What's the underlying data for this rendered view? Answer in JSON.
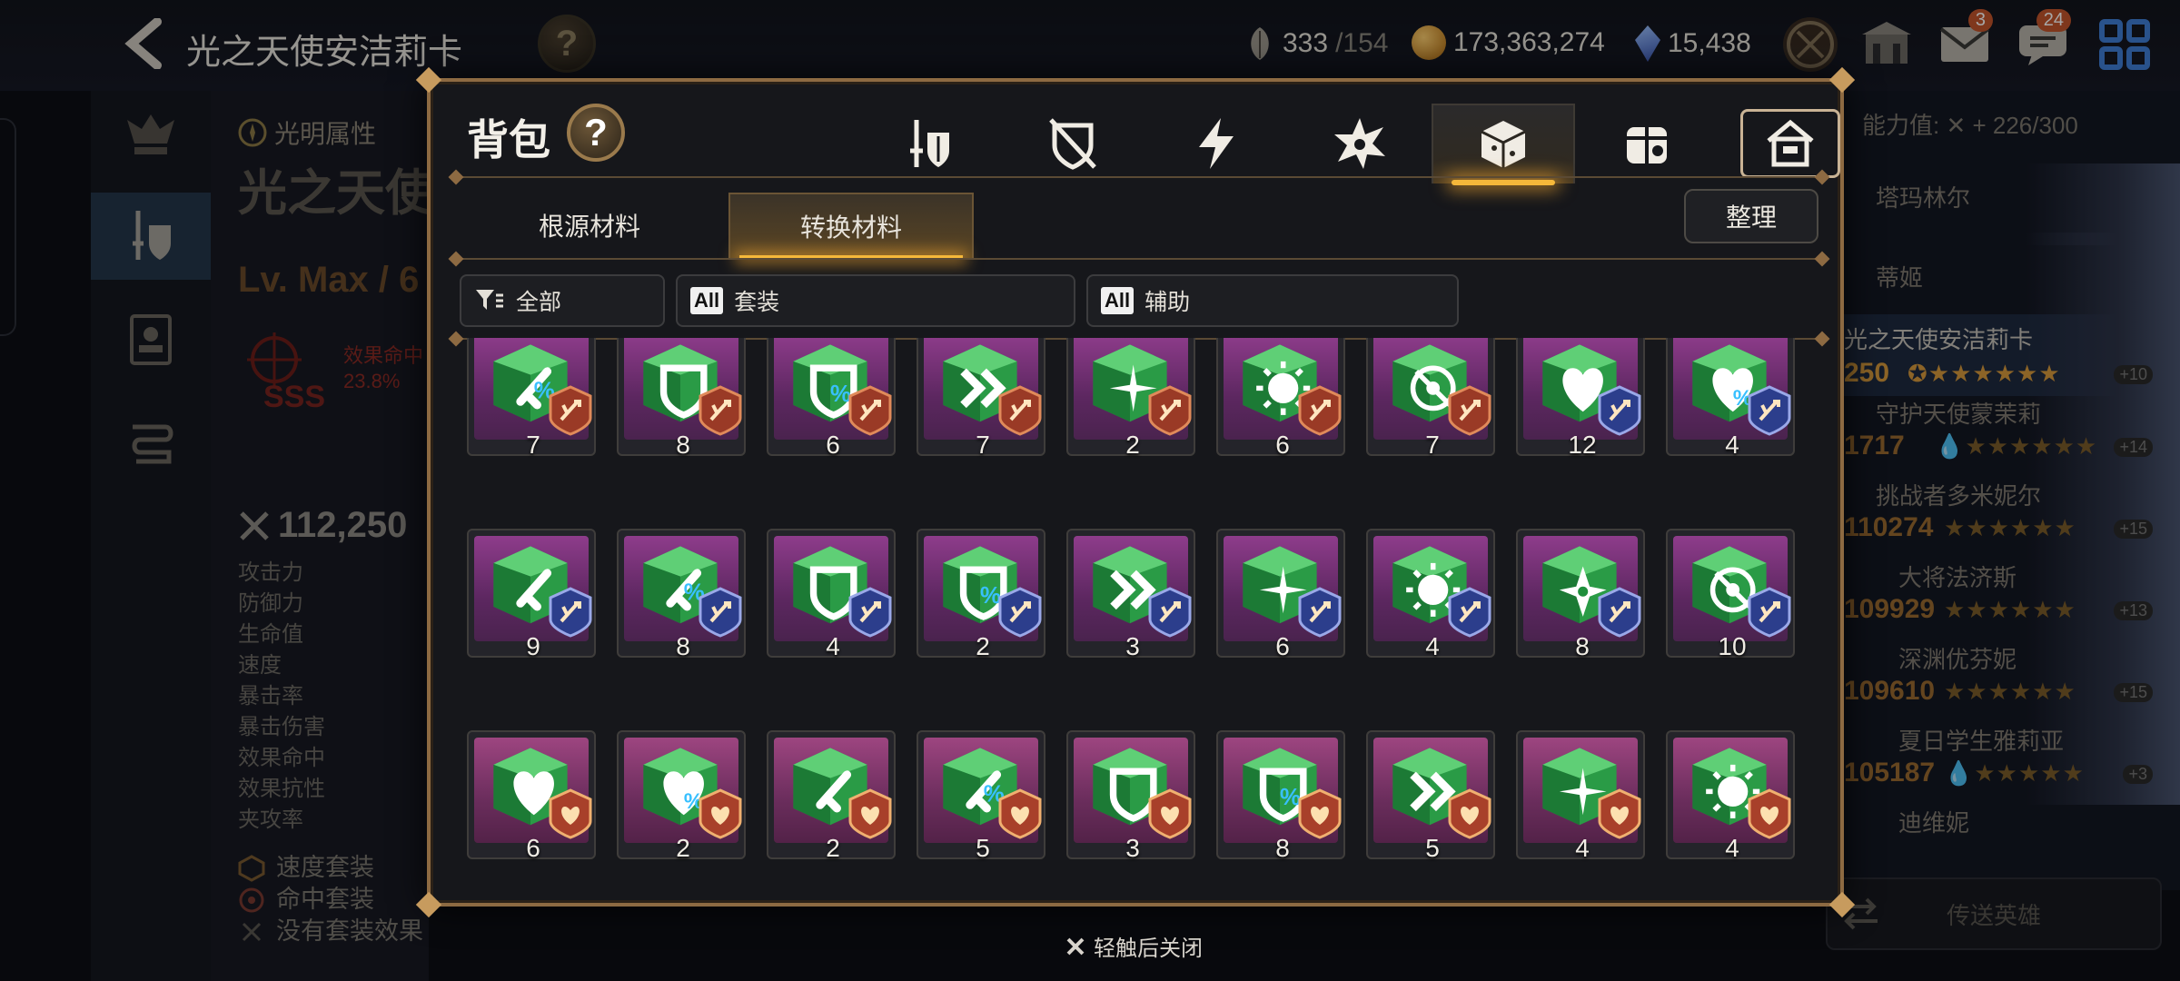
{
  "topbar": {
    "hero_name": "光之天使安洁莉卡",
    "resources": [
      {
        "icon": "leaf-stamina-icon",
        "value": "333",
        "max": "/154"
      },
      {
        "icon": "gold-coin-icon",
        "value": "173,363,274"
      },
      {
        "icon": "skystone-gem-icon",
        "value": "15,438"
      }
    ],
    "mail_badge": "3",
    "chat_badge": "24"
  },
  "hero_panel": {
    "attribute": "光明属性",
    "name": "光之天使",
    "level": "Lv. Max / 6",
    "effect_label": "效果命中",
    "effect_value": "23.8%",
    "power": "112,250",
    "stats": [
      "攻击力",
      "防御力",
      "生命值",
      "速度",
      "暴击率",
      "暴击伤害",
      "效果命中",
      "效果抗性",
      "夹攻率"
    ],
    "sets": [
      "速度套装",
      "命中套装",
      "没有套装效果"
    ]
  },
  "right_list": {
    "ability_label": "能力值:",
    "ability_value": "226/300",
    "heroes": [
      {
        "name": "塔玛林尔",
        "power": "",
        "plus": ""
      },
      {
        "name": "蒂姬",
        "power": "",
        "plus": ""
      },
      {
        "name": "光之天使安洁莉卡",
        "power": "250",
        "plus": "+10"
      },
      {
        "name": "守护天使蒙茉莉",
        "power": "1717",
        "plus": "+14"
      },
      {
        "name": "挑战者多米妮尔",
        "power": "110274",
        "plus": "+15"
      },
      {
        "name": "大将法济斯",
        "power": "109929",
        "plus": "+13"
      },
      {
        "name": "深渊优芬妮",
        "power": "109610",
        "plus": "+15"
      },
      {
        "name": "夏日学生雅莉亚",
        "power": "105187",
        "plus": "+3"
      },
      {
        "name": "迪维妮",
        "power": "",
        "plus": ""
      }
    ],
    "send_button": "传送英雄"
  },
  "modal": {
    "title": "背包",
    "category_tabs": [
      {
        "icon": "weapon-armor-icon",
        "active": false
      },
      {
        "icon": "broken-shield-icon",
        "active": false
      },
      {
        "icon": "lightning-icon",
        "active": false
      },
      {
        "icon": "burst-icon",
        "active": false
      },
      {
        "icon": "material-cube-icon",
        "active": true
      },
      {
        "icon": "scroll-bag-icon",
        "active": false
      },
      {
        "icon": "storage-house-icon",
        "active": false
      }
    ],
    "sub_tabs": [
      "根源材料",
      "转换材料"
    ],
    "active_sub_tab": 1,
    "sort_label": "整理",
    "filters": [
      {
        "icon": "filter-icon",
        "label": "全部",
        "all": false
      },
      {
        "icon": "",
        "label": "套装",
        "all": true
      },
      {
        "icon": "",
        "label": "辅助",
        "all": true
      }
    ],
    "all_label": "All",
    "items": [
      {
        "symbol": "sword-percent",
        "tag": "attack",
        "count": "7"
      },
      {
        "symbol": "shield",
        "tag": "attack",
        "count": "8"
      },
      {
        "symbol": "shield-percent",
        "tag": "attack",
        "count": "6"
      },
      {
        "symbol": "speed",
        "tag": "attack",
        "count": "7"
      },
      {
        "symbol": "crit",
        "tag": "attack",
        "count": "2"
      },
      {
        "symbol": "crit-dmg",
        "tag": "attack",
        "count": "6"
      },
      {
        "symbol": "target",
        "tag": "attack",
        "count": "7"
      },
      {
        "symbol": "heart",
        "tag": "defense",
        "count": "12"
      },
      {
        "symbol": "heart-percent",
        "tag": "defense",
        "count": "4"
      },
      {
        "symbol": "sword",
        "tag": "defense",
        "count": "9"
      },
      {
        "symbol": "sword-percent",
        "tag": "defense",
        "count": "8"
      },
      {
        "symbol": "shield",
        "tag": "defense",
        "count": "4"
      },
      {
        "symbol": "shield-percent",
        "tag": "defense",
        "count": "2"
      },
      {
        "symbol": "speed",
        "tag": "defense",
        "count": "3"
      },
      {
        "symbol": "crit",
        "tag": "defense",
        "count": "6"
      },
      {
        "symbol": "crit-dmg",
        "tag": "defense",
        "count": "4"
      },
      {
        "symbol": "star-hit",
        "tag": "defense",
        "count": "8"
      },
      {
        "symbol": "target",
        "tag": "defense",
        "count": "10"
      },
      {
        "symbol": "heart",
        "tag": "health",
        "count": "6"
      },
      {
        "symbol": "heart-percent",
        "tag": "health",
        "count": "2"
      },
      {
        "symbol": "sword",
        "tag": "health",
        "count": "2"
      },
      {
        "symbol": "sword-percent",
        "tag": "health",
        "count": "5"
      },
      {
        "symbol": "shield",
        "tag": "health",
        "count": "3"
      },
      {
        "symbol": "shield-percent",
        "tag": "health",
        "count": "8"
      },
      {
        "symbol": "speed",
        "tag": "health",
        "count": "5"
      },
      {
        "symbol": "crit",
        "tag": "health",
        "count": "4"
      },
      {
        "symbol": "crit-dmg",
        "tag": "health",
        "count": "4"
      }
    ],
    "close_hint": "轻触后关闭"
  },
  "colors": {
    "frame": "#8d6a42",
    "accent_glow": "#f5b83a",
    "stone_green": "#1f8f3c",
    "tag_attack": "#9a3a26",
    "tag_defense": "#2c3e8c",
    "tag_health": "#a8402a"
  }
}
